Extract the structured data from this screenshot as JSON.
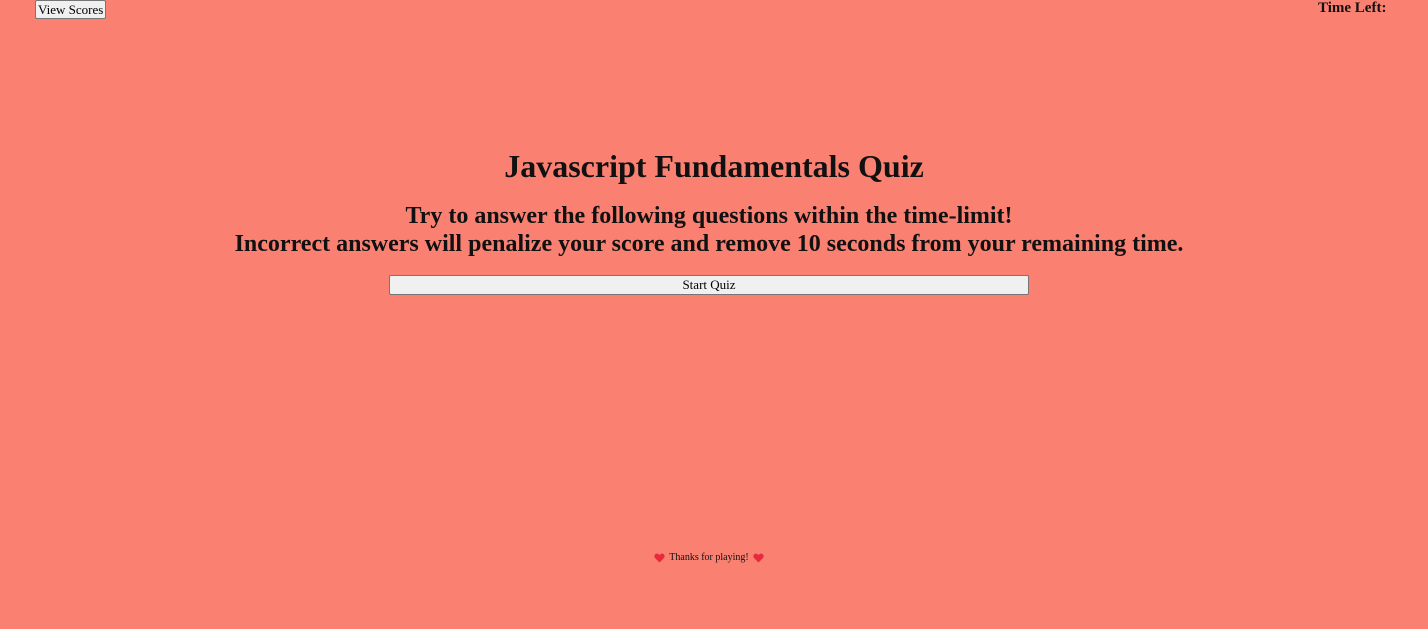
{
  "header": {
    "view_scores_label": "View Scores",
    "time_left_label": "Time Left:",
    "time_left_value": ""
  },
  "main": {
    "title": "Javascript Fundamentals Quiz",
    "instructions_line1": "Try to answer the following questions within the time-limit!",
    "instructions_line2": "Incorrect answers will penalize your score and remove 10 seconds from your remaining time.",
    "start_label": "Start Quiz"
  },
  "footer": {
    "text": "Thanks for playing!",
    "icon": "heart-icon"
  },
  "colors": {
    "background": "#fa8072",
    "heart": "#e8283c"
  }
}
